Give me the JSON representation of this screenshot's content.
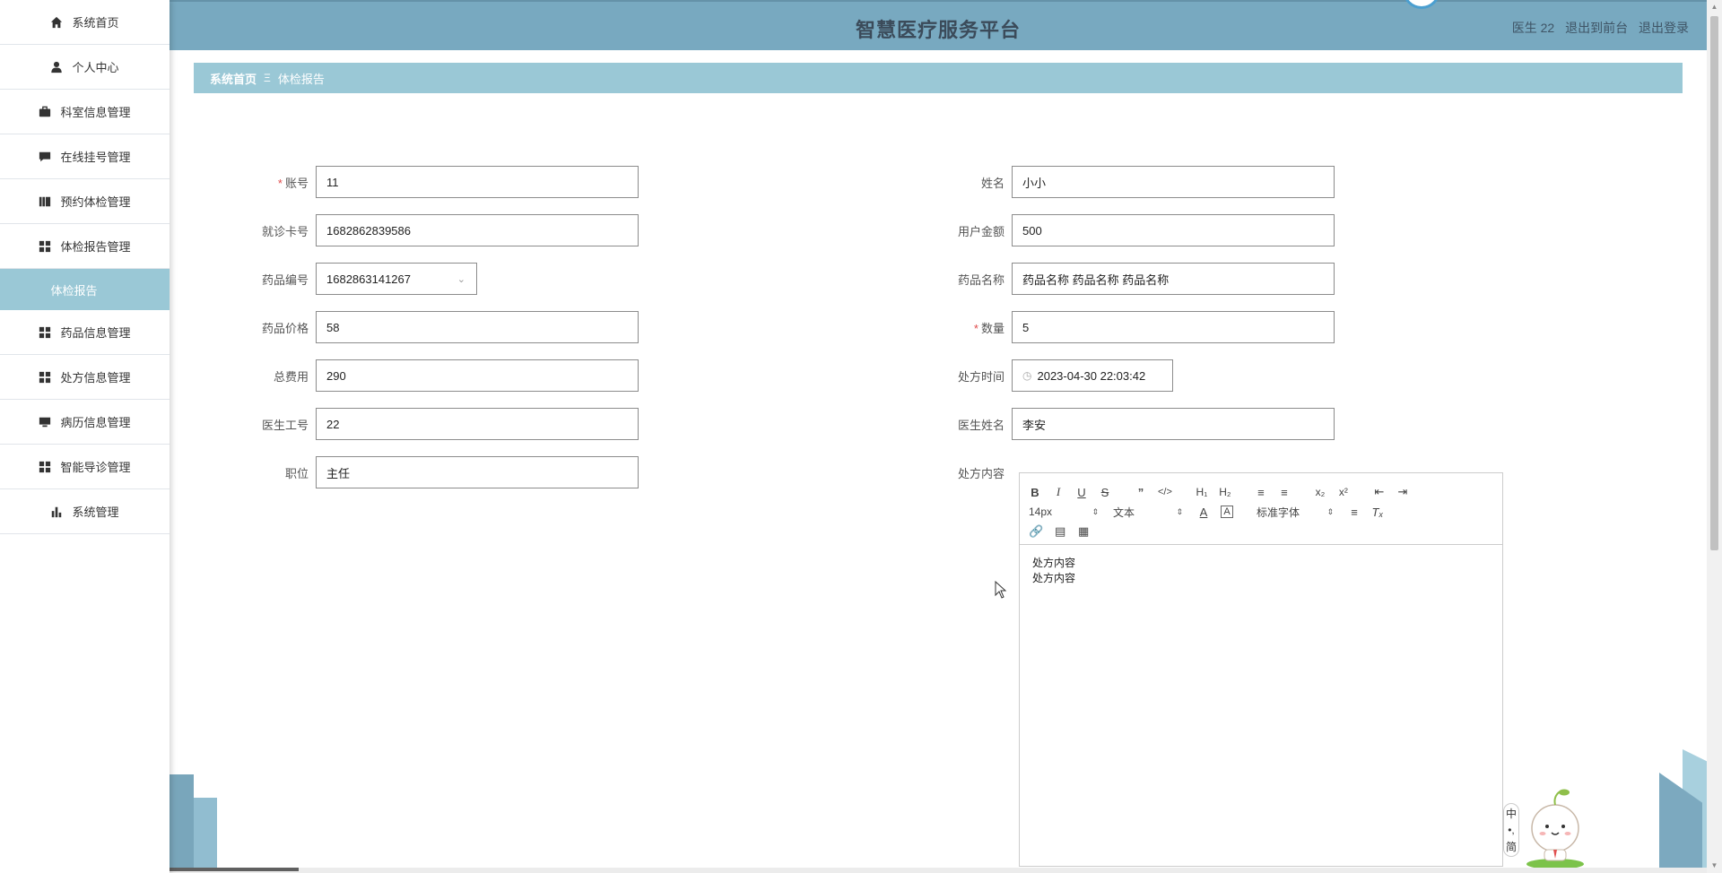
{
  "header": {
    "title": "智慧医疗服务平台",
    "user": "医生 22",
    "link_front": "退出到前台",
    "link_logout": "退出登录"
  },
  "sidebar": {
    "items": [
      {
        "label": "系统首页",
        "icon": "home-icon"
      },
      {
        "label": "个人中心",
        "icon": "user-icon"
      },
      {
        "label": "科室信息管理",
        "icon": "briefcase-icon"
      },
      {
        "label": "在线挂号管理",
        "icon": "comment-icon"
      },
      {
        "label": "预约体检管理",
        "icon": "book-icon"
      },
      {
        "label": "体检报告管理",
        "icon": "grid-icon"
      },
      {
        "label": "药品信息管理",
        "icon": "grid-icon"
      },
      {
        "label": "处方信息管理",
        "icon": "grid-icon"
      },
      {
        "label": "病历信息管理",
        "icon": "monitor-icon"
      },
      {
        "label": "智能导诊管理",
        "icon": "grid-icon"
      },
      {
        "label": "系统管理",
        "icon": "bar-chart-icon"
      }
    ],
    "active_sub": "体检报告"
  },
  "breadcrumb": {
    "home": "系统首页",
    "separator": "Ξ",
    "current": "体检报告"
  },
  "form": {
    "account": {
      "label": "账号",
      "value": "11",
      "required": true
    },
    "name": {
      "label": "姓名",
      "value": "小小"
    },
    "card_no": {
      "label": "就诊卡号",
      "value": "1682862839586"
    },
    "balance": {
      "label": "用户金额",
      "value": "500"
    },
    "drug_no": {
      "label": "药品编号",
      "value": "1682863141267"
    },
    "drug_name": {
      "label": "药品名称",
      "value": "药品名称 药品名称 药品名称"
    },
    "drug_price": {
      "label": "药品价格",
      "value": "58"
    },
    "quantity": {
      "label": "数量",
      "value": "5",
      "required": true
    },
    "total": {
      "label": "总费用",
      "value": "290"
    },
    "rx_time": {
      "label": "处方时间",
      "value": "2023-04-30 22:03:42"
    },
    "doctor_id": {
      "label": "医生工号",
      "value": "22"
    },
    "doctor_name": {
      "label": "医生姓名",
      "value": "李安"
    },
    "position": {
      "label": "职位",
      "value": "主任"
    },
    "rx_content": {
      "label": "处方内容"
    }
  },
  "editor": {
    "font_size": "14px",
    "paragraph": "文本",
    "font_family": "标准字体",
    "content_lines": [
      "处方内容",
      "处方内容"
    ]
  },
  "lang_switch": {
    "zh": "中",
    "dot": "•,",
    "simp": "简"
  },
  "colors": {
    "header_bg": "#78a9c0",
    "breadcrumb_bg": "#9ac8d6",
    "required": "#e04b4b"
  }
}
